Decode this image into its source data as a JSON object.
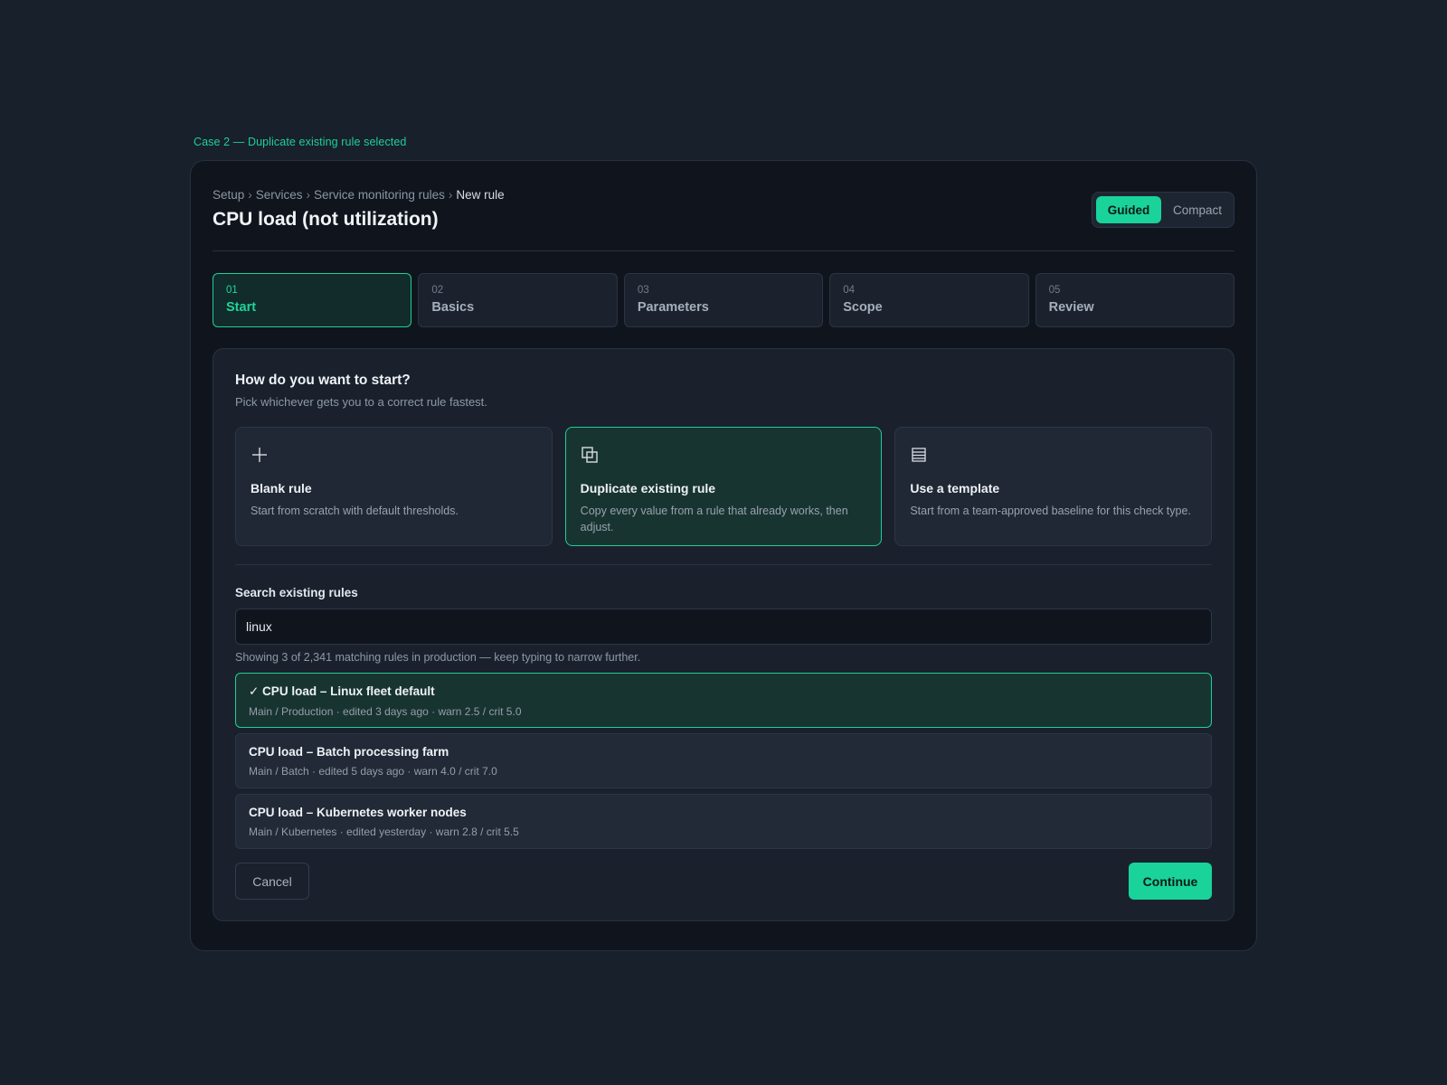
{
  "case_label": "Case 2 — Duplicate existing rule selected",
  "breadcrumb": {
    "items": [
      "Setup",
      "Services",
      "Service monitoring rules",
      "New rule"
    ],
    "separator": "›"
  },
  "page_title": "CPU load (not utilization)",
  "mode_toggle": {
    "guided": "Guided",
    "compact": "Compact",
    "active": "guided"
  },
  "steps": [
    {
      "num": "01",
      "label": "Start",
      "active": true
    },
    {
      "num": "02",
      "label": "Basics",
      "active": false
    },
    {
      "num": "03",
      "label": "Parameters",
      "active": false
    },
    {
      "num": "04",
      "label": "Scope",
      "active": false
    },
    {
      "num": "05",
      "label": "Review",
      "active": false
    }
  ],
  "start": {
    "title": "How do you want to start?",
    "subtitle": "Pick whichever gets you to a correct rule fastest.",
    "options": [
      {
        "icon": "plus-icon",
        "title": "Blank rule",
        "desc": "Start from scratch with default thresholds.",
        "active": false
      },
      {
        "icon": "duplicate-icon",
        "title": "Duplicate existing rule",
        "desc": "Copy every value from a rule that already works, then adjust.",
        "active": true
      },
      {
        "icon": "template-icon",
        "title": "Use a template",
        "desc": "Start from a team-approved baseline for this check type.",
        "active": false
      }
    ]
  },
  "search": {
    "label": "Search existing rules",
    "value": "linux",
    "hint": "Showing 3 of 2,341 matching rules in production — keep typing to narrow further."
  },
  "results": [
    {
      "title": "✓ CPU load – Linux fleet default",
      "meta": "Main / Production · edited 3 days ago · warn 2.5 / crit 5.0",
      "selected": true
    },
    {
      "title": "CPU load – Batch processing farm",
      "meta": "Main / Batch · edited 5 days ago · warn 4.0 / crit 7.0",
      "selected": false
    },
    {
      "title": "CPU load – Kubernetes worker nodes",
      "meta": "Main / Kubernetes · edited yesterday · warn 2.8 / crit 5.5",
      "selected": false
    }
  ],
  "actions": {
    "cancel": "Cancel",
    "continue": "Continue"
  },
  "colors": {
    "accent": "#1ad39a",
    "background": "#18202b",
    "surface": "#10151d"
  }
}
